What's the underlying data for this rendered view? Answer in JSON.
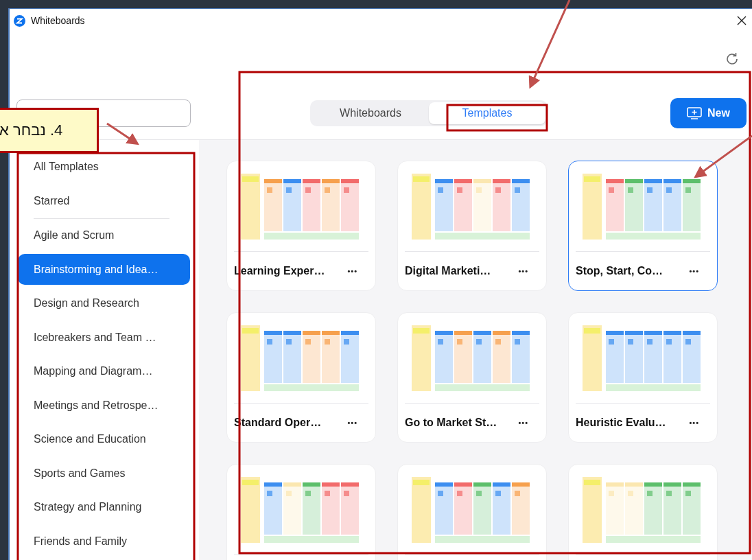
{
  "window": {
    "title": "Whiteboards"
  },
  "tabs": [
    {
      "label": "Whiteboards",
      "selected": false
    },
    {
      "label": "Templates",
      "selected": true
    }
  ],
  "new_button": {
    "label": "New"
  },
  "sidebar": {
    "items": [
      {
        "label": "All Templates",
        "selected": false,
        "divider_after": false
      },
      {
        "label": "Starred",
        "selected": false,
        "divider_after": true
      },
      {
        "label": "Agile and Scrum",
        "selected": false,
        "divider_after": false
      },
      {
        "label": "Brainstorming and Idea…",
        "selected": true,
        "divider_after": false
      },
      {
        "label": "Design and Research",
        "selected": false,
        "divider_after": false
      },
      {
        "label": "Icebreakers and Team …",
        "selected": false,
        "divider_after": false
      },
      {
        "label": "Mapping and Diagram…",
        "selected": false,
        "divider_after": false
      },
      {
        "label": "Meetings and Retrospe…",
        "selected": false,
        "divider_after": false
      },
      {
        "label": "Science and Education",
        "selected": false,
        "divider_after": false
      },
      {
        "label": "Sports and Games",
        "selected": false,
        "divider_after": false
      },
      {
        "label": "Strategy and Planning",
        "selected": false,
        "divider_after": false
      },
      {
        "label": "Friends and Family",
        "selected": false,
        "divider_after": false
      }
    ]
  },
  "templates": [
    {
      "title": "Learning Exper…",
      "more": "•••",
      "selected": false
    },
    {
      "title": "Digital Marketi…",
      "more": "•••",
      "selected": false
    },
    {
      "title": "Stop, Start, Co…",
      "more": "•••",
      "selected": true
    },
    {
      "title": "Standard Oper…",
      "more": "•••",
      "selected": false
    },
    {
      "title": "Go to Market St…",
      "more": "•••",
      "selected": false
    },
    {
      "title": "Heuristic Evalu…",
      "more": "•••",
      "selected": false
    },
    {
      "selected": false
    },
    {
      "selected": false
    },
    {
      "selected": false
    }
  ],
  "annotation": {
    "callout": "4. נבחר א"
  }
}
